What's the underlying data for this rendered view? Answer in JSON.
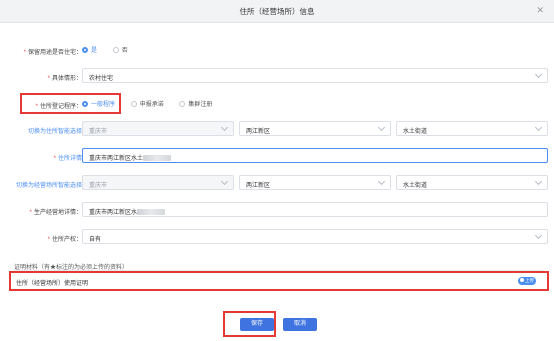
{
  "dialog": {
    "title": "住所（经营场所）信息"
  },
  "form": {
    "reserve_label": "保留用途是否住宅：",
    "reserve_options": [
      "是",
      "否"
    ],
    "situation_label": "具体情形：",
    "situation_value": "农村住宅",
    "reg_label": "住所登记程序：",
    "reg_options": [
      "一般程序",
      "申报承诺",
      "集群注册"
    ],
    "smart_addr_label": "切换为住所智能选择",
    "smart_addr_city": "重庆市",
    "smart_addr_district": "两江新区",
    "smart_addr_street": "水土街道",
    "detail_label": "住所详情",
    "detail_value": "重庆市两江新区水土",
    "biz_smart_label": "切换为经营场所智能选择",
    "biz_city": "重庆市",
    "biz_district": "两江新区",
    "biz_street": "水土街道",
    "biz_detail_label": "生产经营地详情：",
    "biz_detail_value": "重庆市两江新区水",
    "property_label": "住所产权：",
    "property_value": "自有"
  },
  "certificates": {
    "section_title": "证明材料（有★标注的为必须上传的资料）",
    "item_label": "住所（经营场所）使用证明",
    "upload_label": "上传"
  },
  "buttons": {
    "save": "保存",
    "cancel": "取消"
  },
  "colors": {
    "accent": "#4b8ef0",
    "primary_button": "#3f74e0",
    "highlight": "#e53935"
  }
}
